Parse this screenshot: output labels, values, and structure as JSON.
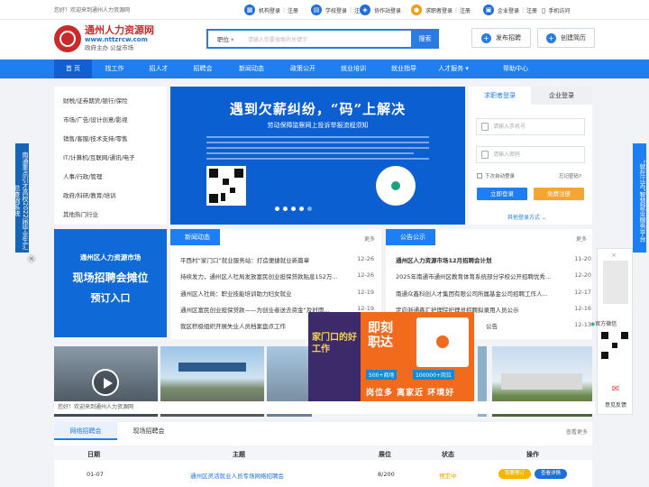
{
  "topbar": {
    "welcome": "您好！欢迎来到通州人力资源网",
    "links": [
      {
        "icon": "building-icon",
        "a": "机构登录",
        "b": "注册"
      },
      {
        "icon": "school-icon",
        "a": "学校登录",
        "b": "注册"
      },
      {
        "icon": "partner-icon",
        "a": "协作站登录"
      },
      {
        "icon": "user-icon",
        "a": "求职者登录",
        "b": "注册"
      },
      {
        "icon": "company-icon",
        "a": "企业登录",
        "b": "注册"
      },
      {
        "icon": "phone-icon",
        "a": "手机访问"
      }
    ]
  },
  "brand": {
    "title": "通州人力资源网",
    "url": "www.nttzrcw.com",
    "slogan": "政府主办 公益市场",
    "colors": {
      "red": "#c92a2a",
      "blue": "#1e7ef3"
    }
  },
  "search": {
    "category": "职位",
    "placeholder": "请输入你要搜索的关键字",
    "button": "搜索"
  },
  "header_buttons": {
    "post_job": "发布招聘",
    "create_resume": "创建简历"
  },
  "nav": [
    "首 页",
    "找工作",
    "招人才",
    "招聘会",
    "新闻动态",
    "政策公开",
    "就业培训",
    "就业指导",
    "人才服务",
    "帮助中心"
  ],
  "categories": [
    "财税/证券期货/银行/保险",
    "市场/广告/设计创意/影视",
    "销售/客服/技术支持/零售",
    "IT/计算机/互联网/通讯/电子",
    "人事/行政/管理",
    "政府/科研/教育/培训",
    "其他热门行业"
  ],
  "banner": {
    "title": "遇到欠薪纠纷，“码”上解决",
    "subtitle": "劳动保障监察网上投诉举报流程须知"
  },
  "login": {
    "tab_seeker": "求职者登录",
    "tab_company": "企业登录",
    "phone_placeholder": "请输入手机号",
    "password_placeholder": "请输入密码",
    "auto_login": "下次自动登录",
    "forgot": "忘记密码?",
    "login_btn": "立即登录",
    "register_btn": "免费注册",
    "other": "其他登录方式"
  },
  "left_side_ad": "南通重点引才高校2022届毕业生汇总查询系统",
  "right_side_ad": "“就在江苏”智慧就业服务平台",
  "promo_left": {
    "line1": "通州区人力资源市场",
    "line2": "现场招聘会摊位",
    "line3": "预订入口"
  },
  "news": {
    "title": "新闻动态",
    "more": "更多",
    "items": [
      {
        "text": "平西村“家门口”就业服务站：打造便捷就业新篇章",
        "date": "12-26"
      },
      {
        "text": "持续发力，通州区人社局发放富民创业担保贷款贴息152万...",
        "date": "12-26"
      },
      {
        "text": "通州区人社局：职业技能培训助力妇女就业",
        "date": "12-19"
      },
      {
        "text": "通州区富民创业担保贷款——为创业者送去资金“及时雨...",
        "date": "12-19"
      },
      {
        "text": "我区积极组织开展失业人员档案盘点工作",
        "date": ""
      }
    ]
  },
  "notice": {
    "title": "公告公示",
    "more": "更多",
    "items": [
      {
        "text": "通州区人力资源市场12月招聘会计划",
        "date": "11-20",
        "bold": true
      },
      {
        "text": "2025年南通市通州区教育体育系统部分学校公开招聘优秀...",
        "date": "12-20"
      },
      {
        "text": "南通众鑫科创人才集团有限公司所属基金公司招聘工作人...",
        "date": "12-17"
      },
      {
        "text": "定向浙通鑫汇护理院护理员招聘拟录用人员公示",
        "date": "12-16"
      },
      {
        "text": "公告",
        "date": "12-13"
      }
    ]
  },
  "popup": {
    "title_left": "家门口的好工作",
    "title_right": "即刻职达",
    "stat1": "500+商场",
    "stat2": "100000+岗位",
    "tagline": "岗位多 离家近 环境好"
  },
  "right_float": {
    "wechat": "官方微信",
    "feedback": "意见反馈"
  },
  "footnote": "您好！欢迎来到通州人力资源网",
  "job_section": {
    "tab_online": "网络招聘会",
    "tab_onsite": "现场招聘会",
    "more": "查看更多",
    "headers": [
      "日期",
      "主题",
      "展位",
      "状态",
      "操作"
    ],
    "rows": [
      {
        "date": "01-07",
        "title": "通州区灵活就业人员专场网络招聘会",
        "booth": "8/200",
        "status": "预定中",
        "btn1": "我要预订",
        "btn2": "查看详情"
      }
    ]
  }
}
